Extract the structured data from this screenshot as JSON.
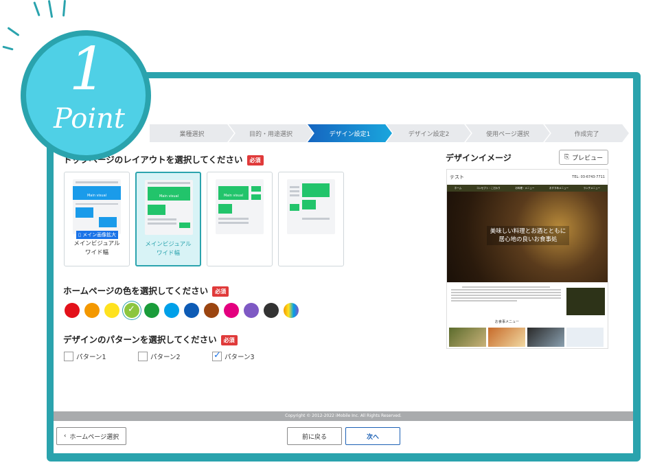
{
  "badge": {
    "number": "1",
    "word": "Point"
  },
  "steps": [
    "業種選択",
    "目的・用途選択",
    "デザイン設定1",
    "デザイン設定2",
    "使用ページ選択",
    "作成完了"
  ],
  "active_step": 2,
  "layout_section": {
    "title": "トップページのレイアウトを選択してください",
    "required": "必須"
  },
  "layout_cards": [
    {
      "label": "メインビジュアル\nワイド幅",
      "main_visual": "Main visual",
      "badge": "メイン画像拡大"
    },
    {
      "label": "メインビジュアル\nワイド幅",
      "main_visual": "Main visual"
    },
    {
      "main_visual": "Main visual"
    },
    {
      "main_visual": ""
    }
  ],
  "color_section": {
    "title": "ホームページの色を選択してください",
    "required": "必須"
  },
  "colors": [
    "#e3111a",
    "#f39800",
    "#ffe21f",
    "#8cc63f",
    "#1a9c3a",
    "#00a0e9",
    "#0d5bb5",
    "#9b4510",
    "#e4007f",
    "#7e59c4",
    "#333333",
    "gradient"
  ],
  "selected_color": 3,
  "pattern_section": {
    "title": "デザインのパターンを選択してください",
    "required": "必須"
  },
  "patterns": [
    {
      "label": "パターン1",
      "checked": false
    },
    {
      "label": "パターン2",
      "checked": false
    },
    {
      "label": "パターン3",
      "checked": true
    }
  ],
  "preview": {
    "title": "デザインイメージ",
    "button": "プレビュー",
    "site_name": "テスト",
    "tel": "TEL: 03-6743-7711",
    "nav": [
      "ホーム",
      "コンセプト・こだわり",
      "お料理・メニュー",
      "おすすめメニュー",
      "ランチメニュー"
    ],
    "hero_copy": "美味しい料理とお酒とともに居心地の良いお食事処",
    "sub_heading": "お食事メニュー"
  },
  "footer": {
    "copyright": "Copyright © 2012-2022 iMobile Inc. All Rights Reserved.",
    "back_home": "ホームページ選択",
    "prev": "前に戻る",
    "next": "次へ"
  }
}
